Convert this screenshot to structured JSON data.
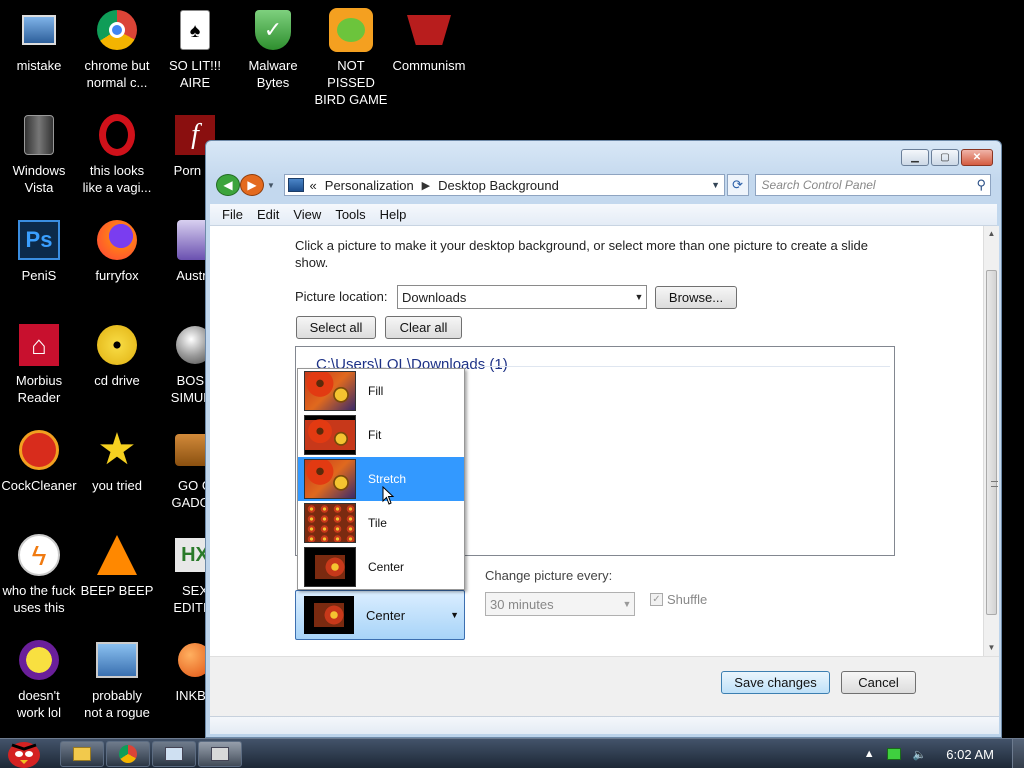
{
  "desktop": {
    "icons": [
      {
        "label": "mistake",
        "icon": "computer-icon"
      },
      {
        "label": "chrome but normal c...",
        "icon": "chrome-icon"
      },
      {
        "label": "SO LIT!!!\nAIRE",
        "icon": "solitaire-icon"
      },
      {
        "label": "Malware\nBytes",
        "icon": "shield-icon"
      },
      {
        "label": "NOT PISSED\nBIRD GAME",
        "icon": "green-pig-icon"
      },
      {
        "label": "Communism",
        "icon": "red-emblem-icon"
      },
      {
        "label": "Windows\nVista",
        "icon": "trash-can-icon"
      },
      {
        "label": "this looks\nlike a vagi...",
        "icon": "opera-icon"
      },
      {
        "label": "Porn Pl",
        "icon": "flash-icon"
      },
      {
        "label": "PeniS",
        "icon": "photoshop-icon"
      },
      {
        "label": "furryfox",
        "icon": "firefox-icon"
      },
      {
        "label": "Austra",
        "icon": "purple-app-icon"
      },
      {
        "label": "Morbius\nReader",
        "icon": "pdf-icon"
      },
      {
        "label": "cd drive",
        "icon": "cd-icon"
      },
      {
        "label": "BOSN\nSIMULA",
        "icon": "gear-ball-icon"
      },
      {
        "label": "CockCleaner",
        "icon": "ccleaner-icon"
      },
      {
        "label": "you tried",
        "icon": "star-icon"
      },
      {
        "label": "GO G\nGADGE",
        "icon": "briefcase-icon"
      },
      {
        "label": "who the fuck\nuses this",
        "icon": "lightning-icon"
      },
      {
        "label": "BEEP BEEP",
        "icon": "vlc-cone-icon"
      },
      {
        "label": "SEX\nEDITIO",
        "icon": "hx-icon"
      },
      {
        "label": "doesn't\nwork lol",
        "icon": "yahoo-icon"
      },
      {
        "label": "probably\nnot a rogue",
        "icon": "gears-monitor-icon"
      },
      {
        "label": "INKBA",
        "icon": "orange-ball-icon"
      }
    ]
  },
  "window": {
    "breadcrumb": {
      "overflow": "«",
      "items": [
        "Personalization",
        "Desktop Background"
      ]
    },
    "search_placeholder": "Search Control Panel",
    "menu": [
      "File",
      "Edit",
      "View",
      "Tools",
      "Help"
    ],
    "description": "Click a picture to make it your desktop background, or select more than one picture to create a slide show.",
    "picture_location_label": "Picture location:",
    "picture_location_value": "Downloads",
    "browse_label": "Browse...",
    "select_all_label": "Select all",
    "clear_all_label": "Clear all",
    "folder_header": "C:\\Users\\LOL\\Downloads (1)",
    "change_picture_label": "Change picture every:",
    "interval_value": "30 minutes",
    "shuffle_label": "Shuffle",
    "shuffle_checked": true,
    "position_value": "Center",
    "save_label": "Save changes",
    "cancel_label": "Cancel"
  },
  "position_menu": {
    "selected_index": 2,
    "items": [
      {
        "label": "Fill",
        "thumb": "flower"
      },
      {
        "label": "Fit",
        "thumb": "fit"
      },
      {
        "label": "Stretch",
        "thumb": "flower"
      },
      {
        "label": "Tile",
        "thumb": "tile"
      },
      {
        "label": "Center",
        "thumb": "center"
      }
    ]
  },
  "taskbar": {
    "clock": "6:02 AM"
  },
  "colors": {
    "selection": "#3399ff",
    "link_blue": "#1e3287"
  }
}
